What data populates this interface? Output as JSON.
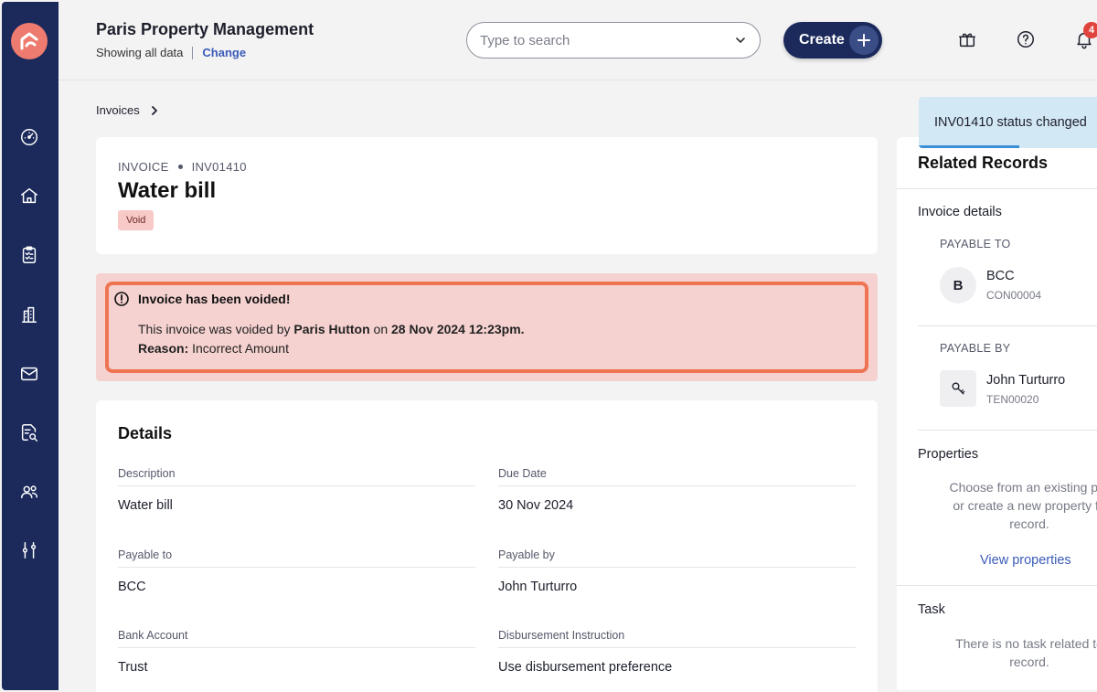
{
  "app": {
    "company_title": "Paris Property Management",
    "showing_text": "Showing all data",
    "change_label": "Change",
    "notification_count": "4"
  },
  "search": {
    "placeholder": "Type to search"
  },
  "create_button": {
    "label": "Create"
  },
  "sidebar": {
    "items": [
      {
        "icon": "dashboard-icon"
      },
      {
        "icon": "home-icon"
      },
      {
        "icon": "clipboard-icon"
      },
      {
        "icon": "buildings-icon"
      },
      {
        "icon": "mail-icon"
      },
      {
        "icon": "report-search-icon"
      },
      {
        "icon": "users-icon"
      },
      {
        "icon": "sliders-icon"
      }
    ]
  },
  "breadcrumb": {
    "invoices": "Invoices"
  },
  "invoice": {
    "type_label": "INVOICE",
    "number": "INV01410",
    "title": "Water bill",
    "status": "Void"
  },
  "alert": {
    "title": "Invoice has been voided!",
    "line_prefix": "This invoice was voided by",
    "voided_by": "Paris Hutton",
    "on_text": "on",
    "voided_at": "28 Nov 2024 12:23pm.",
    "reason_label": "Reason:",
    "reason": "Incorrect Amount"
  },
  "details": {
    "title": "Details",
    "fields": [
      {
        "label": "Description",
        "value": "Water bill"
      },
      {
        "label": "Due Date",
        "value": "30 Nov 2024"
      },
      {
        "label": "Payable to",
        "value": "BCC"
      },
      {
        "label": "Payable by",
        "value": "John Turturro"
      },
      {
        "label": "Bank Account",
        "value": "Trust"
      },
      {
        "label": "Disbursement Instruction",
        "value": "Use disbursement preference"
      }
    ]
  },
  "toast": {
    "message": "INV01410 status changed"
  },
  "related": {
    "title": "Related Records",
    "invoice_details": "Invoice details",
    "payable_to_label": "PAYABLE TO",
    "payable_to": {
      "initial": "B",
      "name": "BCC",
      "code": "CON00004"
    },
    "payable_by_label": "PAYABLE BY",
    "payable_by": {
      "name": "John Turturro",
      "code": "TEN00020"
    },
    "properties_label": "Properties",
    "properties_line1": "Choose from an existing pro",
    "properties_line2": "or create a new property fo",
    "properties_line3": "record.",
    "view_properties": "View properties",
    "task_label": "Task",
    "task_line1": "There is no task related to",
    "task_line2": "record."
  },
  "colors": {
    "sidebar": "#1b2a5b",
    "accent": "#ee7b6f",
    "alert_border": "#ee7452",
    "alert_bg": "#f5d2d0",
    "link": "#3a5bb8",
    "toast_bg": "#d3e8f5"
  }
}
